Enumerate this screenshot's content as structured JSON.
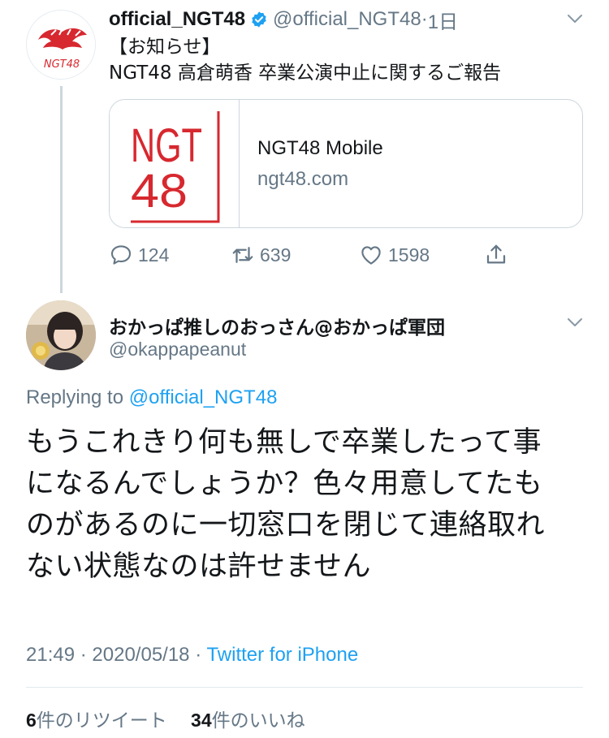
{
  "parent_tweet": {
    "display_name": "official_NGT48",
    "handle": "@official_NGT48",
    "separator": "·",
    "time": "1日",
    "text_line1": "【お知らせ】",
    "text_line2": "NGT48 高倉萌香 卒業公演中止に関するご報告",
    "card": {
      "logo_line1": "NGT",
      "logo_line2": "48",
      "title": "NGT48 Mobile",
      "url": "ngt48.com"
    },
    "actions": {
      "replies": "124",
      "retweets": "639",
      "likes": "1598"
    }
  },
  "reply_tweet": {
    "display_name": "おかっぱ推しのおっさん@おかっぱ軍団",
    "handle": "@okappapeanut",
    "replying_prefix": "Replying to",
    "replying_to": "@official_NGT48",
    "text_lines": [
      "もうこれきり何も無しで卒業したって事",
      "になるんでしょうか？色々用意してたも",
      "のがあるのに一切窓口を閉じて連絡取れ",
      "ない状態なのは許せません"
    ],
    "time": "21:49",
    "date": "2020/05/18",
    "meta_separator": "·",
    "source": "Twitter for iPhone",
    "retweet_count": "6",
    "retweet_label": "件のリツイート",
    "like_count": "34",
    "like_label": "件のいいね"
  },
  "colors": {
    "accent": "#1da1f2",
    "secondary_text": "#657786",
    "primary_text": "#14171a",
    "ngt_red": "#d7282f"
  },
  "icons": [
    "ngt48-avatar-icon",
    "verified-badge-icon",
    "chevron-down-icon",
    "reply-icon",
    "retweet-icon",
    "like-icon",
    "share-icon"
  ]
}
